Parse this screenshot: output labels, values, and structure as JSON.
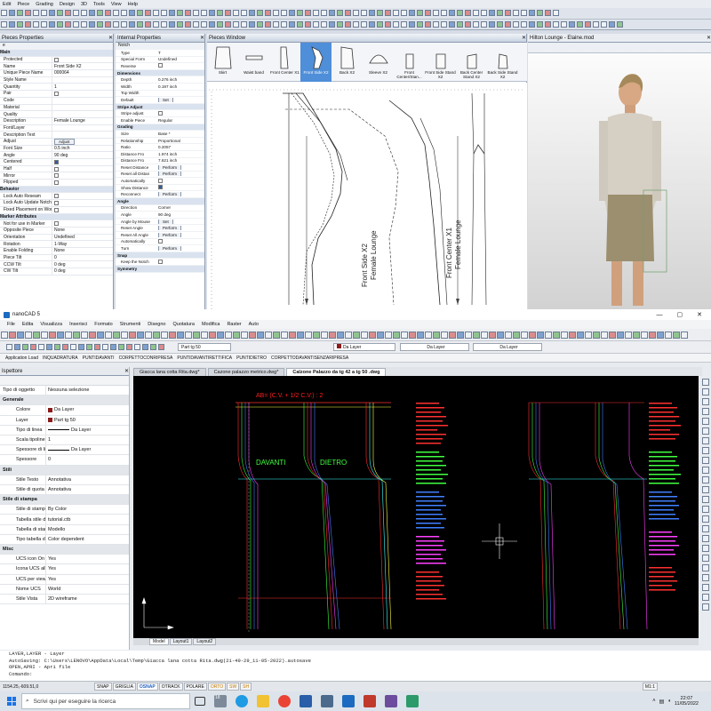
{
  "top": {
    "menu": [
      "Edit",
      "Piece",
      "Grading",
      "Design",
      "3D",
      "Tools",
      "View",
      "Help"
    ],
    "pieces_properties": {
      "title": "Pieces Properties",
      "tab": "e",
      "rows": [
        {
          "k": "Main",
          "sec": true
        },
        {
          "k": "Protected",
          "chk": false
        },
        {
          "k": "Name",
          "v": "Front Side X2"
        },
        {
          "k": "Unique Piece Name",
          "v": "000064"
        },
        {
          "k": "Style Name",
          "v": ""
        },
        {
          "k": "Quantity",
          "v": "1"
        },
        {
          "k": "Pair",
          "chk": false
        },
        {
          "k": "Code",
          "v": ""
        },
        {
          "k": "Material",
          "v": ""
        },
        {
          "k": "Quality",
          "v": ""
        },
        {
          "k": "Description",
          "v": "Female Lounge"
        },
        {
          "k": "Font/Layer",
          "v": ""
        },
        {
          "k": "Description Text",
          "v": ""
        },
        {
          "k": "Adjust",
          "btn": "Adjust"
        },
        {
          "k": "Font Size",
          "v": "0.5 inch"
        },
        {
          "k": "Angle",
          "v": "90 deg"
        },
        {
          "k": "Centered",
          "chk": true
        },
        {
          "k": "Half",
          "chk": false
        },
        {
          "k": "Mirror",
          "chk": false
        },
        {
          "k": "Flipped",
          "chk": false
        },
        {
          "k": "Behavior",
          "sec": true
        },
        {
          "k": "Lock Auto Reseam",
          "chk": false
        },
        {
          "k": "Lock Auto Update Notch",
          "chk": false
        },
        {
          "k": "Fixed Placement on Worklist",
          "chk": false
        },
        {
          "k": "Marker Attributes",
          "sec": true
        },
        {
          "k": "Not for use in Marker",
          "chk": false
        },
        {
          "k": "Opposite Piece",
          "v": "None"
        },
        {
          "k": "Orientation",
          "v": "Undefined"
        },
        {
          "k": "Rotation",
          "v": "1-Way"
        },
        {
          "k": "Enable Folding",
          "v": "None"
        },
        {
          "k": "Piece Tilt",
          "v": "0"
        },
        {
          "k": "CCW Tilt",
          "v": "0 deg"
        },
        {
          "k": "CW Tilt",
          "v": "0 deg"
        }
      ]
    },
    "internal_properties": {
      "title": "Internal Properties",
      "sub": "Notch",
      "rows": [
        {
          "k": "Type",
          "v": "T"
        },
        {
          "k": "Special Form",
          "v": "Undefined"
        },
        {
          "k": "Reverse",
          "chk": false
        },
        {
          "k": "Dimensions",
          "sec": true
        },
        {
          "k": "Depth",
          "v": "0.276 inch"
        },
        {
          "k": "Width",
          "v": "0.197 inch"
        },
        {
          "k": "Top Width",
          "v": ""
        },
        {
          "k": "Default",
          "btn": "Set"
        },
        {
          "k": "Stripe Adjust",
          "sec": true
        },
        {
          "k": "Stripe adjust",
          "chk": false
        },
        {
          "k": "Enable Piece",
          "v": "Regular"
        },
        {
          "k": "Grading",
          "sec": true
        },
        {
          "k": "Size",
          "v": "Base *"
        },
        {
          "k": "Relationship",
          "v": "Proportional"
        },
        {
          "k": "Ratio",
          "v": "0.2057"
        },
        {
          "k": "Distance Fro",
          "v": "1.974 inch"
        },
        {
          "k": "Distance Fro",
          "v": "7.621 inch"
        },
        {
          "k": "Reset Distance",
          "btn": "Perform"
        },
        {
          "k": "Reset all Distan",
          "btn": "Perform"
        },
        {
          "k": "Automatically",
          "chk": false
        },
        {
          "k": "Show Distance",
          "chk": true
        },
        {
          "k": "Reconnect",
          "btn": "Perform"
        },
        {
          "k": "Angle",
          "sec": true
        },
        {
          "k": "Direction",
          "v": "Corner"
        },
        {
          "k": "Angle",
          "v": "90 deg"
        },
        {
          "k": "Angle by Mouse",
          "btn": "Set"
        },
        {
          "k": "Reset Angle",
          "btn": "Perform"
        },
        {
          "k": "Reset All Angle",
          "btn": "Perform"
        },
        {
          "k": "Automatically",
          "chk": false
        },
        {
          "k": "Turn",
          "btn": "Perform"
        },
        {
          "k": "Snap",
          "sec": true
        },
        {
          "k": "Keep the Notch",
          "chk": false
        },
        {
          "k": "Symmetry",
          "sec": true
        }
      ]
    },
    "pieces_window": {
      "title": "Pieces Window",
      "thumbs": [
        {
          "l": "Skirt"
        },
        {
          "l": "Waist band"
        },
        {
          "l": "Front Center X1"
        },
        {
          "l": "Front Side X2",
          "sel": true
        },
        {
          "l": "Back X2"
        },
        {
          "l": "Sleeve X2"
        },
        {
          "l": "Front Center/Stan..."
        },
        {
          "l": "Front Side Stand X2"
        },
        {
          "l": "Back Center Stand X2"
        },
        {
          "l": "Back Side Stand X2"
        }
      ],
      "piece_labels": [
        "Front Side X2",
        "Female Lounge",
        "Front Center X1",
        "Female Lounge"
      ]
    },
    "viewer_title": "Hilton Lounge - Elaine.mod"
  },
  "nano": {
    "title": "nanoCAD 5",
    "menu": [
      "File",
      "Edita",
      "Visualizza",
      "Inserisci",
      "Formato",
      "Strumenti",
      "Disegno",
      "Quotatura",
      "Modifica",
      "Raster",
      "Auto"
    ],
    "layer_dd1": "Part tg 50",
    "layer_dd2": "Da Layer",
    "layer_dd3": "Da Layer",
    "layer_dd4": "Da Layer",
    "app_toolbar": [
      "Application Load",
      "INQUADRATURA",
      "PUNTIDAVANTI",
      "CORPETTOCONRIPRESA",
      "PUNTIDAVANTIRETTIFICA",
      "PUNTIDIETRO",
      "CORPETTODAVANTISENZARIPRESA"
    ],
    "inspector": {
      "title": "Ispettore",
      "type_k": "Tipo di oggetto",
      "type_v": "Nessuna selezione",
      "rows": [
        {
          "k": "Generale",
          "sec": true
        },
        {
          "k": "Colore",
          "v": "Da Layer",
          "sw": "#8b1a1a"
        },
        {
          "k": "Layer",
          "v": "Part tg 50",
          "sw": "#8b1a1a"
        },
        {
          "k": "Tipo di linea",
          "v": "Da Layer",
          "line": true
        },
        {
          "k": "Scala tipolinea",
          "v": "1"
        },
        {
          "k": "Spessore di linea",
          "v": "Da Layer",
          "line": true
        },
        {
          "k": "Spessore",
          "v": "0"
        },
        {
          "k": "Stili",
          "sec": true
        },
        {
          "k": "Stile Testo",
          "v": "Annotativa"
        },
        {
          "k": "Stile di quota",
          "v": "Annotativa"
        },
        {
          "k": "Stile di stampa",
          "sec": true
        },
        {
          "k": "Stile di stampa",
          "v": "By Color"
        },
        {
          "k": "Tabella stile di s...",
          "v": "tutorial.ctb"
        },
        {
          "k": "Tabella di stamp...",
          "v": "Modello"
        },
        {
          "k": "Tipo tabella di st...",
          "v": "Color dependent"
        },
        {
          "k": "Misc",
          "sec": true
        },
        {
          "k": "UCS icon On",
          "v": "Yes"
        },
        {
          "k": "Icona UCS all'or...",
          "v": "Yes"
        },
        {
          "k": "UCS per viewport",
          "v": "Yes"
        },
        {
          "k": "Nome UCS",
          "v": "World"
        },
        {
          "k": "Stile Vista",
          "v": "2D wireframe"
        }
      ]
    },
    "doc_tabs": [
      "Giacca lana cotta Rita.dwg*",
      "Cazone palazzo metrico.dwg*",
      "Calzone Palazzo da tg 42 a tg 50 .dwg"
    ],
    "drawing": {
      "formula": "AB= (C.V. + 1/2 C.V.) : 2",
      "davanti": "DAVANTI",
      "dietro": "DIETRO"
    },
    "layout_tabs": [
      "Model",
      "Layout1",
      "Layout2"
    ],
    "cmd_lines": [
      "LAYER,LAYER - Layer",
      "AutoSaving: C:\\Users\\LENOVO\\AppData\\Local\\Temp\\Giacca lana cotta Rita.dwg(21-49-29_11-05-2022).autosave",
      "OPEN,APRI - Apri file",
      "Comando:"
    ],
    "coords": "1154.25,-609.51,0",
    "status_btns": [
      {
        "t": "SNAP"
      },
      {
        "t": "GRIGLIA"
      },
      {
        "t": "OSNAP",
        "on": true
      },
      {
        "t": "OTRACK"
      },
      {
        "t": "POLARE"
      },
      {
        "t": "ORTO",
        "warn": true
      },
      {
        "t": "SW",
        "warn": true
      },
      {
        "t": "SH",
        "warn": true
      }
    ],
    "scale": "M1:1"
  },
  "taskbar": {
    "search": "Scrivi qui per eseguire la ricerca",
    "time": "22:07",
    "date": "11/05/2022",
    "badge": "18"
  }
}
